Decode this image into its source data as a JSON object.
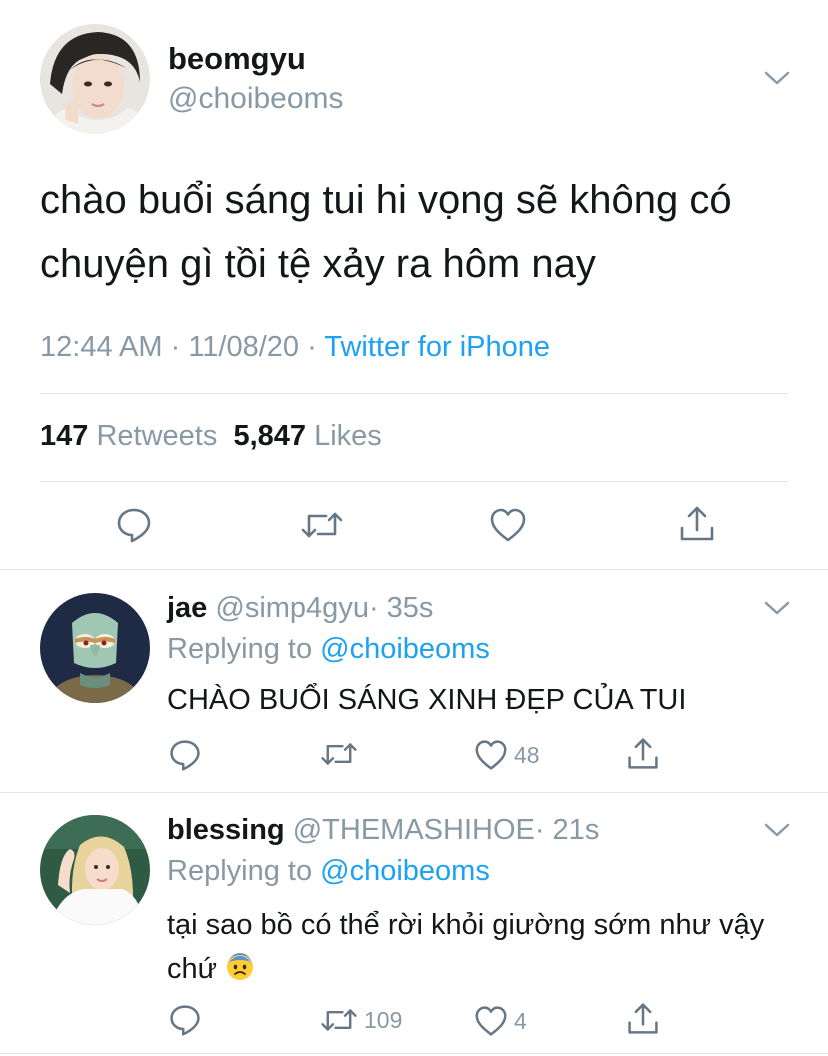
{
  "main_tweet": {
    "name": "beomgyu",
    "handle": "@choibeoms",
    "text": "chào buổi sáng tui hi vọng sẽ không có chuyện gì tồi tệ xảy ra hôm nay",
    "time": "12:44 AM",
    "date": "11/08/20",
    "separator": "·",
    "source": "Twitter for iPhone",
    "retweets_count": "147",
    "retweets_label": "Retweets",
    "likes_count": "5,847",
    "likes_label": "Likes"
  },
  "replies": [
    {
      "name": "jae",
      "handle": "@simp4gyu",
      "age": "· 35s",
      "replying_label": "Replying to",
      "replying_to": "@choibeoms",
      "text": "CHÀO BUỔI SÁNG XINH ĐẸP CỦA TUI",
      "retweets": "",
      "likes": "48"
    },
    {
      "name": "blessing",
      "handle": "@THEMASHIHOE",
      "age": "· 21s",
      "replying_label": "Replying to",
      "replying_to": "@choibeoms",
      "text": "tại sao bồ có thể rời khỏi giường sớm như vậy chứ",
      "emoji": "anxious-face-with-sweat-icon",
      "retweets": "109",
      "likes": "4"
    }
  ],
  "colors": {
    "accent": "#1da1f2",
    "secondary_text": "#8899a6",
    "divider": "#e1e8ed"
  }
}
